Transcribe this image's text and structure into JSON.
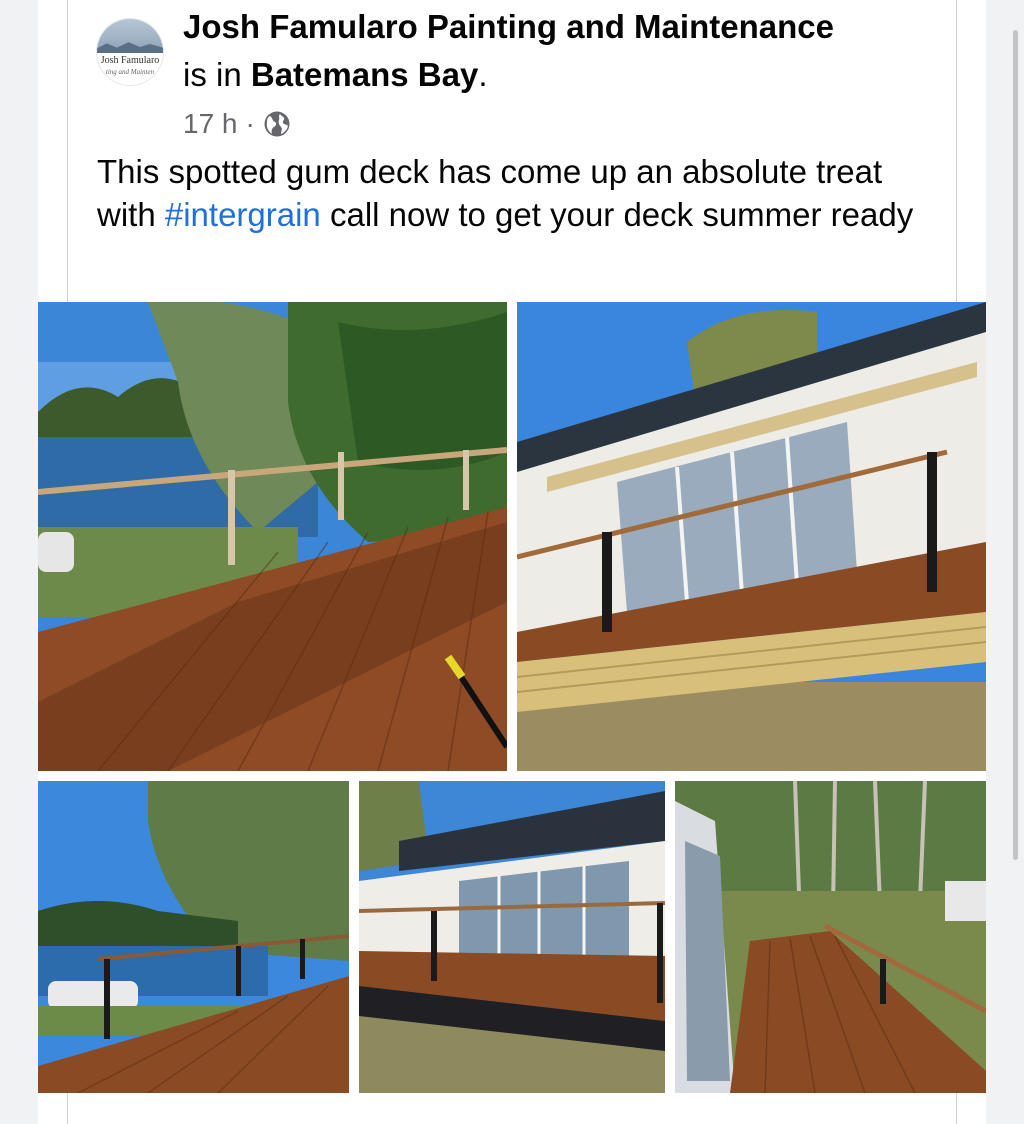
{
  "post": {
    "page_name": "Josh Famularo Painting and Maintenance",
    "checkin_prefix": "is in",
    "location": "Batemans Bay",
    "checkin_suffix": ".",
    "time": "17 h",
    "separator": "·",
    "audience_icon": "globe-icon",
    "text_part1": "This spotted gum deck has come up an absolute treat with ",
    "hashtag": "#intergrain",
    "text_part2": " call now to get your deck summer ready",
    "avatar": {
      "line1": "Josh Famularo",
      "line2": "ting and Mainten"
    }
  },
  "photos": [
    {
      "name": "deck-lake-view-photo"
    },
    {
      "name": "house-deck-photo"
    },
    {
      "name": "deck-lake-car-photo"
    },
    {
      "name": "house-deck-front-photo"
    },
    {
      "name": "deck-yard-photo"
    }
  ],
  "colors": {
    "hashtag": "#216fdb",
    "meta": "#65676b",
    "deck": "#8a4a24",
    "sky": "#3d84d6"
  }
}
